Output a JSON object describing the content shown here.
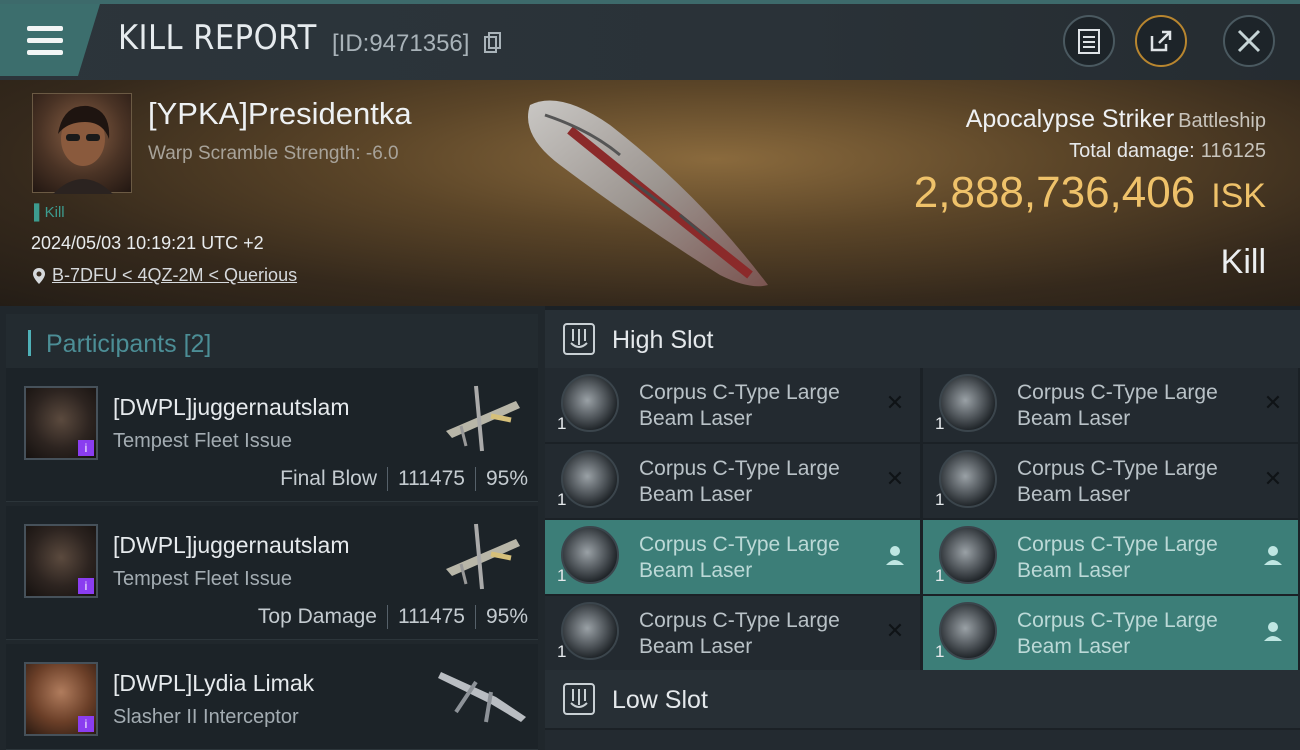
{
  "header": {
    "title": "KILL REPORT",
    "kill_id": "[ID:9471356]"
  },
  "victim": {
    "name": "[YPKA]Presidentka",
    "warp_scramble": "Warp Scramble Strength: -6.0",
    "tag": "Kill",
    "datetime": "2024/05/03 10:19:21 UTC +2",
    "location": "B-7DFU < 4QZ-2M < Querious",
    "ship_name": "Apocalypse Striker",
    "ship_class": "Battleship",
    "total_damage_label": "Total damage:",
    "total_damage_value": "116125",
    "isk_value": "2,888,736,406",
    "isk_unit": "ISK",
    "result": "Kill"
  },
  "participants": {
    "title": "Participants",
    "count": "[2]",
    "items": [
      {
        "name": "[DWPL]juggernautslam",
        "ship": "Tempest Fleet Issue",
        "role": "Final Blow",
        "damage": "111475",
        "percent": "95%"
      },
      {
        "name": "[DWPL]juggernautslam",
        "ship": "Tempest Fleet Issue",
        "role": "Top Damage",
        "damage": "111475",
        "percent": "95%"
      },
      {
        "name": "[DWPL]Lydia Limak",
        "ship": "Slasher II Interceptor"
      }
    ]
  },
  "high_slot": {
    "title": "High Slot",
    "modules": [
      {
        "name_line1": "Corpus C-Type Large",
        "name_line2": "Beam Laser",
        "qty": "1",
        "status": "destroyed"
      },
      {
        "name_line1": "Corpus C-Type Large",
        "name_line2": "Beam Laser",
        "qty": "1",
        "status": "destroyed"
      },
      {
        "name_line1": "Corpus C-Type Large",
        "name_line2": "Beam Laser",
        "qty": "1",
        "status": "destroyed"
      },
      {
        "name_line1": "Corpus C-Type Large",
        "name_line2": "Beam Laser",
        "qty": "1",
        "status": "destroyed"
      },
      {
        "name_line1": "Corpus C-Type Large",
        "name_line2": "Beam Laser",
        "qty": "1",
        "status": "dropped"
      },
      {
        "name_line1": "Corpus C-Type Large",
        "name_line2": "Beam Laser",
        "qty": "1",
        "status": "dropped"
      },
      {
        "name_line1": "Corpus C-Type Large",
        "name_line2": "Beam Laser",
        "qty": "1",
        "status": "destroyed"
      },
      {
        "name_line1": "Corpus C-Type Large",
        "name_line2": "Beam Laser",
        "qty": "1",
        "status": "dropped"
      }
    ]
  },
  "low_slot": {
    "title": "Low Slot"
  },
  "icons": {
    "menu": "hamburger-icon",
    "copy": "copy-icon",
    "clipboard": "clipboard-icon",
    "share": "share-icon",
    "close": "close-icon",
    "location": "location-pin-icon",
    "slot": "slot-icon",
    "destroyed": "x-icon",
    "dropped": "person-icon"
  },
  "colors": {
    "accent_teal": "#3c6e6d",
    "isk_gold": "#efc26a",
    "dropped_bg": "#3c7e78",
    "corp_badge": "#8a3df0"
  }
}
